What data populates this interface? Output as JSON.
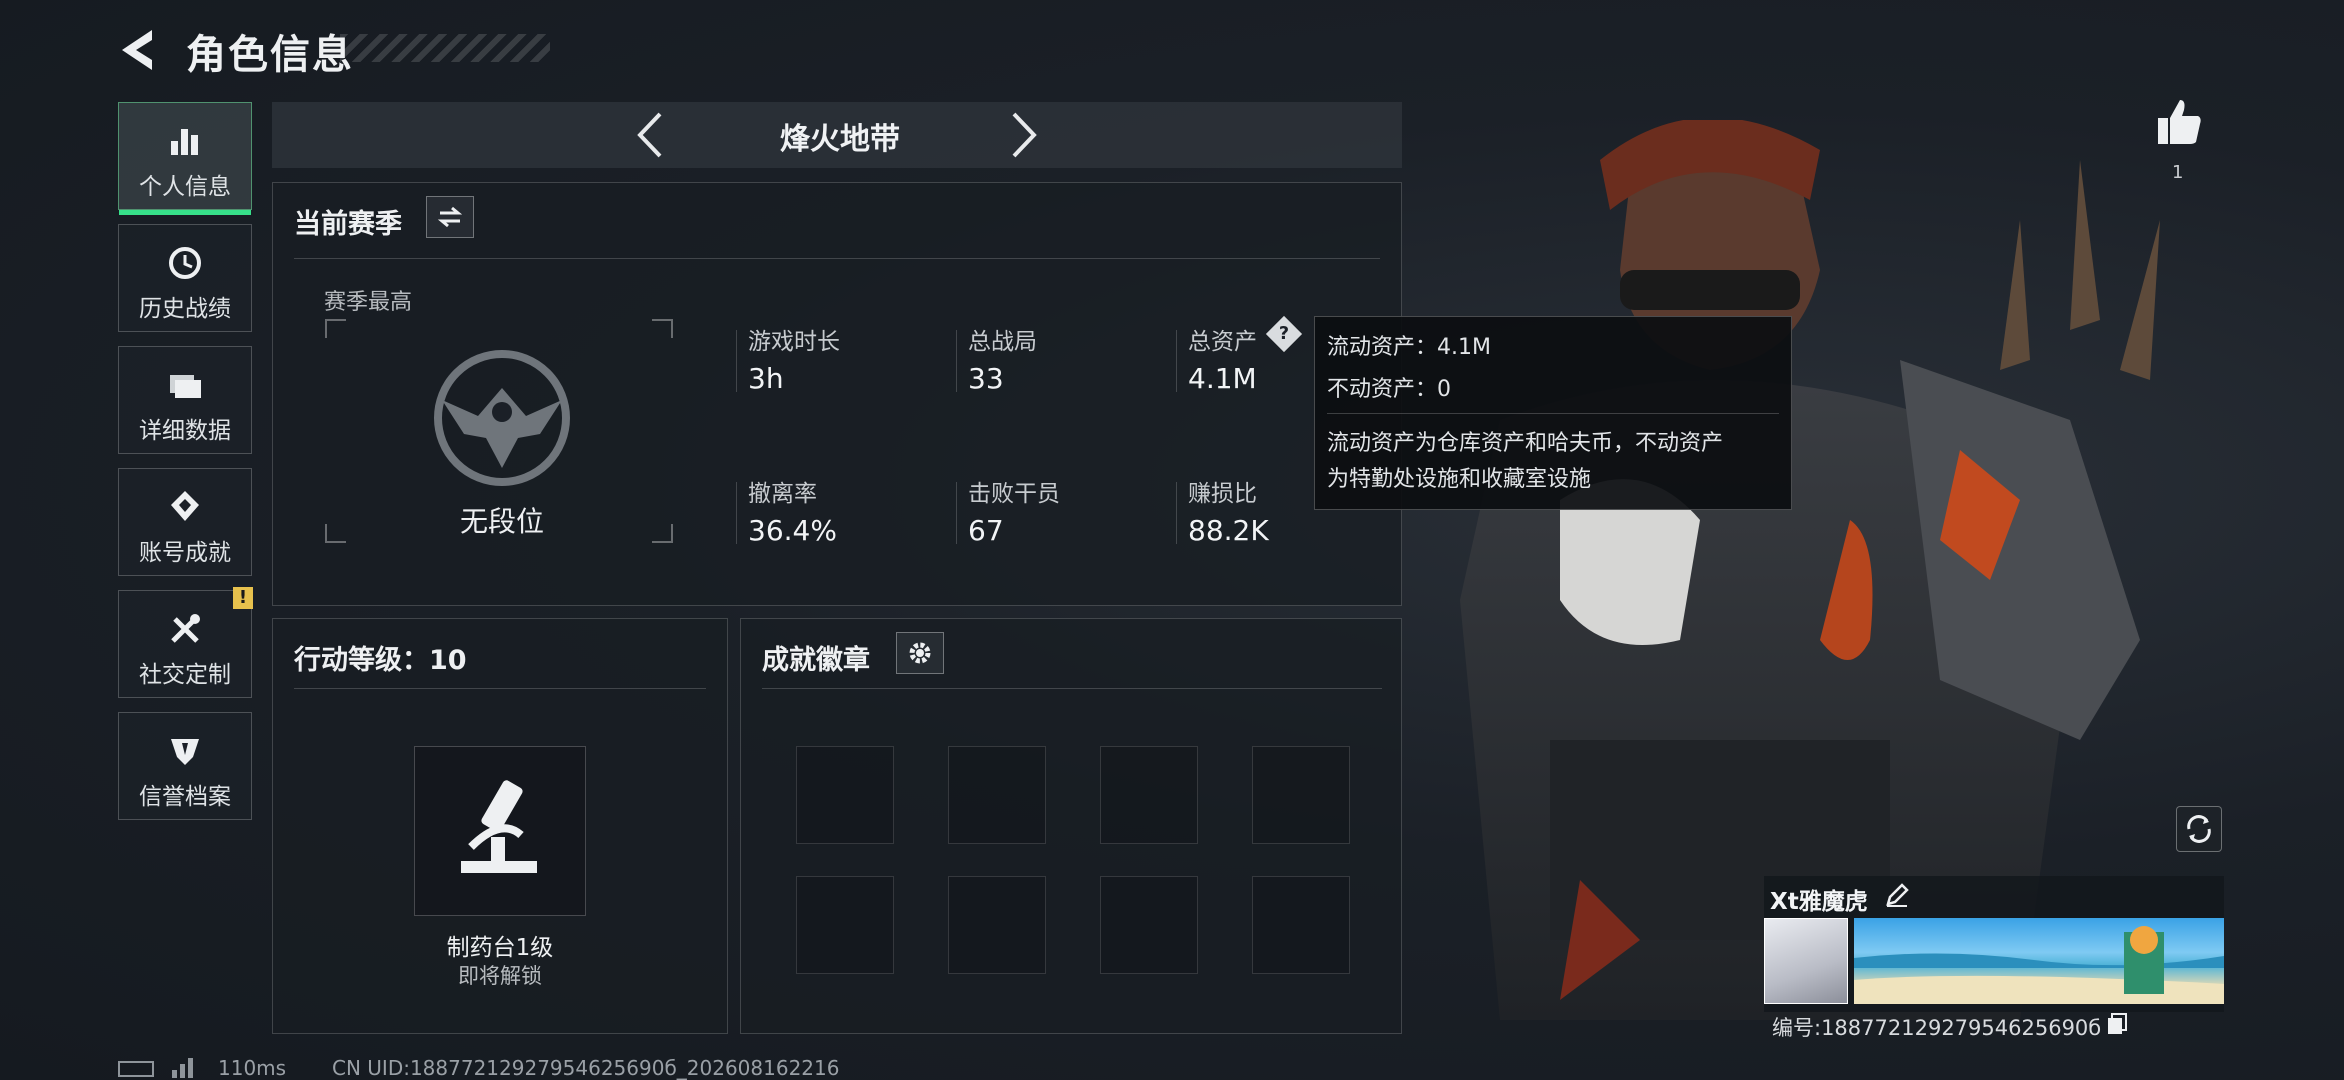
{
  "header": {
    "title": "角色信息"
  },
  "sidebar": {
    "items": [
      {
        "label": "个人信息",
        "icon": "bar-chart-icon",
        "active": true
      },
      {
        "label": "历史战绩",
        "icon": "history-icon"
      },
      {
        "label": "详细数据",
        "icon": "folder-icon"
      },
      {
        "label": "账号成就",
        "icon": "achievement-icon"
      },
      {
        "label": "社交定制",
        "icon": "tools-icon",
        "badge": "!"
      },
      {
        "label": "信誉档案",
        "icon": "credit-icon"
      }
    ]
  },
  "mode": {
    "label": "烽火地带"
  },
  "season": {
    "title": "当前赛季",
    "highest_label": "赛季最高",
    "rank": "无段位",
    "stats": [
      {
        "label": "游戏时长",
        "value": "3h"
      },
      {
        "label": "总战局",
        "value": "33"
      },
      {
        "label": "总资产",
        "value": "4.1M",
        "help": "?"
      },
      {
        "label": "撤离率",
        "value": "36.4%"
      },
      {
        "label": "击败干员",
        "value": "67"
      },
      {
        "label": "赚损比",
        "value": "88.2K"
      }
    ]
  },
  "tooltip": {
    "line1": "流动资产：4.1M",
    "line2": "不动资产：0",
    "note1": "流动资产为仓库资产和哈夫币，不动资产",
    "note2": "为特勤处设施和收藏室设施"
  },
  "action_level": {
    "title": "行动等级：10",
    "unlock_name": "制药台1级",
    "unlock_status": "即将解锁"
  },
  "badges": {
    "title": "成就徽章",
    "slots": 8
  },
  "player": {
    "name": "Xt雅魔虎",
    "likes": "1",
    "id_line": "编号:18877212927954625690б"
  },
  "footer": {
    "ping": "110ms",
    "uid": "CN UID:18877212927954625690б_202608162216"
  },
  "colors": {
    "accent": "#37e08a",
    "alert": "#e7c14d",
    "panel_bg": "#181d23"
  }
}
